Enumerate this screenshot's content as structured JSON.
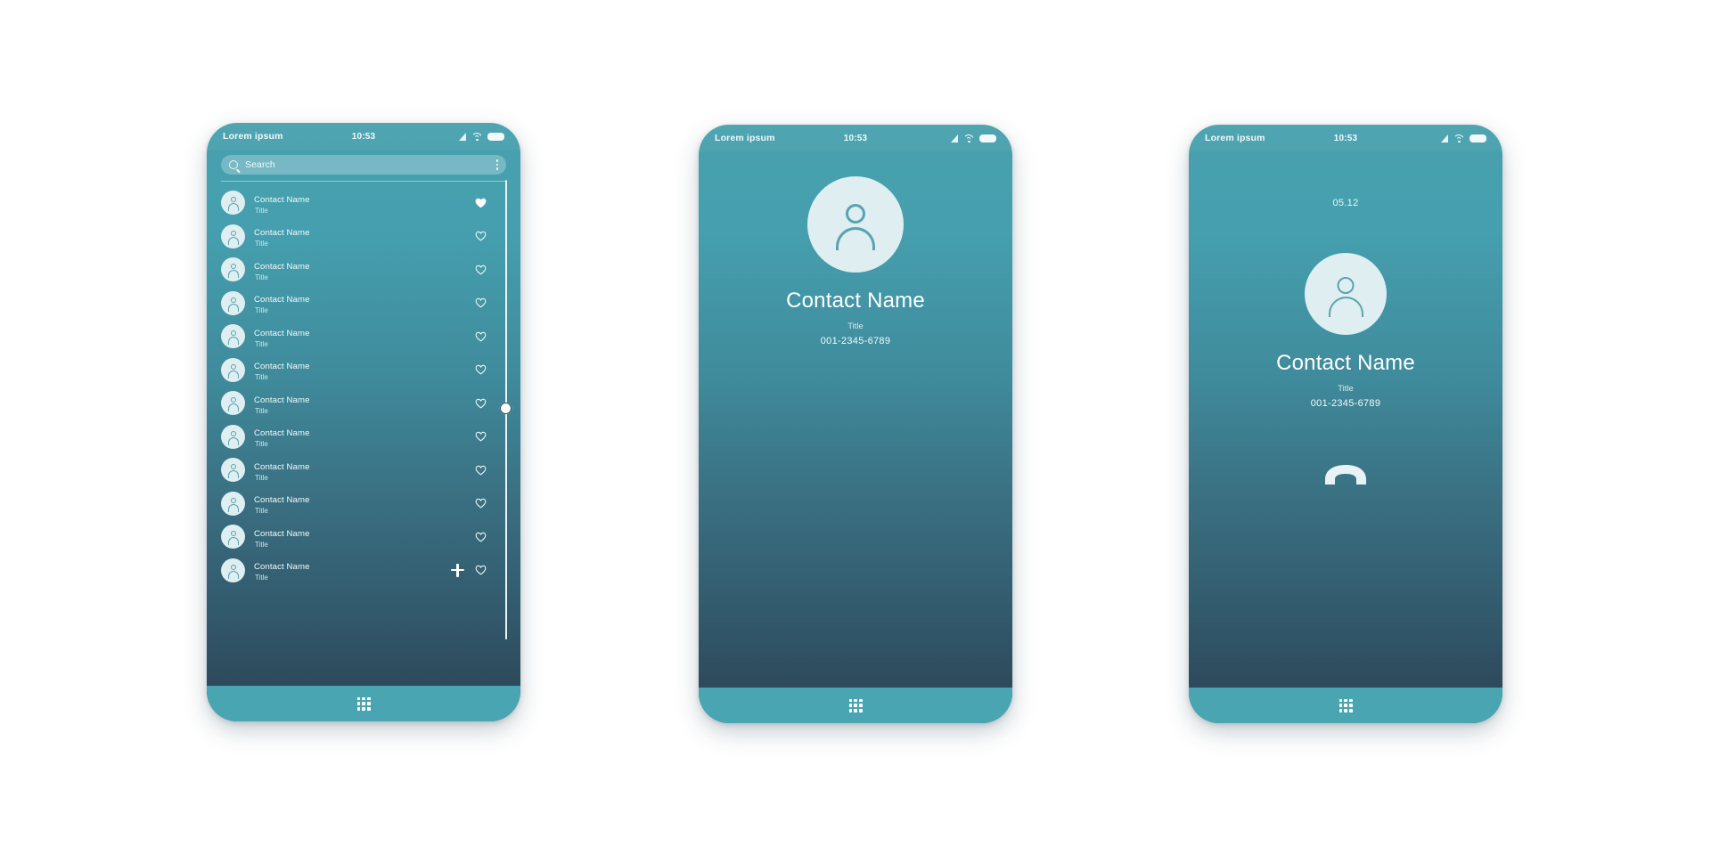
{
  "meta": {
    "screen_count": 3,
    "accent_teal": "#4aa5b2",
    "dark_slate": "#2d4758",
    "avatar_fill": "#dfeef0",
    "avatar_glyph": "#59a3b1"
  },
  "status_bar": {
    "brand": "Lorem ipsum",
    "clock": "10:53",
    "icons": [
      "signal-icon",
      "wifi-icon",
      "battery-icon"
    ]
  },
  "nav": {
    "grid_icon": "grid-apps-icon",
    "dot_count": 9
  },
  "screen_list": {
    "name": "contact-list-screen",
    "search": {
      "placeholder": "Search",
      "value": "",
      "search_icon": "search-icon",
      "menu_icon": "kebab-menu-icon"
    },
    "add_button_label": "+",
    "add_button_icon": "plus-icon",
    "scrollbar": {
      "thumb_position_percent": 48.5
    },
    "contacts": [
      {
        "name": "Contact Name",
        "title": "Title",
        "favorite": true
      },
      {
        "name": "Contact Name",
        "title": "Title",
        "favorite": false
      },
      {
        "name": "Contact Name",
        "title": "Title",
        "favorite": false
      },
      {
        "name": "Contact Name",
        "title": "Title",
        "favorite": false
      },
      {
        "name": "Contact Name",
        "title": "Title",
        "favorite": false
      },
      {
        "name": "Contact Name",
        "title": "Title",
        "favorite": false
      },
      {
        "name": "Contact Name",
        "title": "Title",
        "favorite": false
      },
      {
        "name": "Contact Name",
        "title": "Title",
        "favorite": false
      },
      {
        "name": "Contact Name",
        "title": "Title",
        "favorite": false
      },
      {
        "name": "Contact Name",
        "title": "Title",
        "favorite": false
      },
      {
        "name": "Contact Name",
        "title": "Title",
        "favorite": false
      },
      {
        "name": "Contact Name",
        "title": "Title",
        "favorite": false
      }
    ]
  },
  "screen_detail": {
    "name": "contact-detail-screen",
    "avatar_icon": "person-avatar-icon",
    "contact_name": "Contact Name",
    "contact_title": "Title",
    "contact_phone": "001-2345-6789"
  },
  "screen_call": {
    "name": "active-call-screen",
    "call_timer": "05.12",
    "avatar_icon": "person-avatar-icon",
    "contact_name": "Contact Name",
    "contact_title": "Title",
    "contact_phone": "001-2345-6789",
    "end_call_icon": "end-call-handset-icon"
  }
}
